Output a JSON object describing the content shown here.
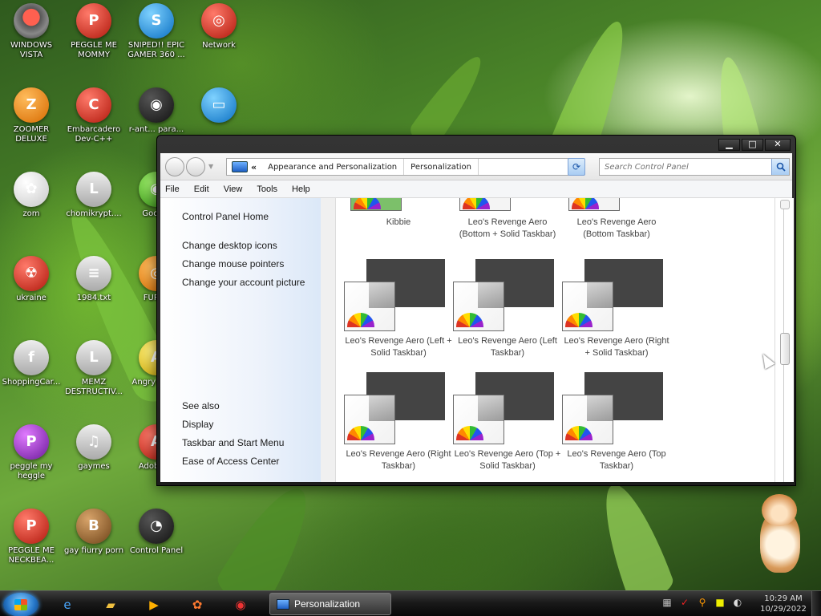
{
  "colors": {
    "window_frame": "#1c1c1c",
    "left_pane_link": "#1b1b1b",
    "theme_label": "#444444",
    "taskbar": "#1a1a1a"
  },
  "desktop_icons": [
    {
      "label": "WINDOWS VISTA",
      "icon": "vista-bowl-icon"
    },
    {
      "label": "PEGGLE ME MOMMY",
      "icon": "peggle-icon"
    },
    {
      "label": "SNIPED!! EPIC GAMER 360 ...",
      "icon": "skype-icon"
    },
    {
      "label": "Network",
      "icon": "network-globe-icon"
    },
    {
      "label": "ZOOMER DELUXE",
      "icon": "zoomer-icon"
    },
    {
      "label": "Embarcadero Dev-C++",
      "icon": "devcpp-icon"
    },
    {
      "label": "r-ant... para...",
      "icon": "red-eye-icon"
    },
    {
      "label": "",
      "icon": "monitor-icon"
    },
    {
      "label": "zom",
      "icon": "flower-icon"
    },
    {
      "label": "chomikrypt....",
      "icon": "chomikrypt-icon"
    },
    {
      "label": "Google",
      "icon": "chrome-icon"
    },
    {
      "label": "ukraine",
      "icon": "radiation-icon"
    },
    {
      "label": "1984.txt",
      "icon": "text-file-icon"
    },
    {
      "label": "FURRY",
      "icon": "firefox-icon"
    },
    {
      "label": "ShoppingCar...",
      "icon": "flash-icon"
    },
    {
      "label": "MEMZ DESTRUCTIV...",
      "icon": "memz-icon"
    },
    {
      "label": "Angry Sea...",
      "icon": "angry-birds-icon"
    },
    {
      "label": "peggle my heggle",
      "icon": "peggle-icon"
    },
    {
      "label": "gaymes",
      "icon": "games-folder-icon"
    },
    {
      "label": "Adobe ...",
      "icon": "adobe-icon"
    },
    {
      "label": "PEGGLE ME NECKBEA...",
      "icon": "peggle-icon"
    },
    {
      "label": "gay fiurry porn",
      "icon": "box-hamster-icon"
    },
    {
      "label": "Control Panel",
      "icon": "control-panel-icon"
    }
  ],
  "window": {
    "breadcrumb": [
      "Appearance and Personalization",
      "Personalization"
    ],
    "breadcrumb_overflow": "«",
    "search_placeholder": "Search Control Panel",
    "menu": [
      "File",
      "Edit",
      "View",
      "Tools",
      "Help"
    ],
    "left_links": {
      "home": "Control Panel Home",
      "tasks": [
        "Change desktop icons",
        "Change mouse pointers",
        "Change your account picture"
      ],
      "see_also_heading": "See also",
      "see_also": [
        "Display",
        "Taskbar and Start Menu",
        "Ease of Access Center"
      ]
    },
    "themes_top_partial": [
      "Kibbie",
      "Leo's Revenge Aero (Bottom + Solid Taskbar)",
      "Leo's Revenge Aero (Bottom Taskbar)"
    ],
    "themes": [
      "Leo's Revenge Aero (Left + Solid Taskbar)",
      "Leo's Revenge Aero (Left Taskbar)",
      "Leo's Revenge Aero (Right + Solid Taskbar)",
      "Leo's Revenge Aero (Right Taskbar)",
      "Leo's Revenge Aero (Top + Solid Taskbar)",
      "Leo's Revenge Aero (Top Taskbar)"
    ]
  },
  "taskbar": {
    "pinned": [
      "internet-explorer-icon",
      "folder-icon",
      "media-player-icon",
      "paint-icon",
      "chrome-icon"
    ],
    "active_task": "Personalization",
    "time": "10:29 AM",
    "date": "10/29/2022"
  }
}
